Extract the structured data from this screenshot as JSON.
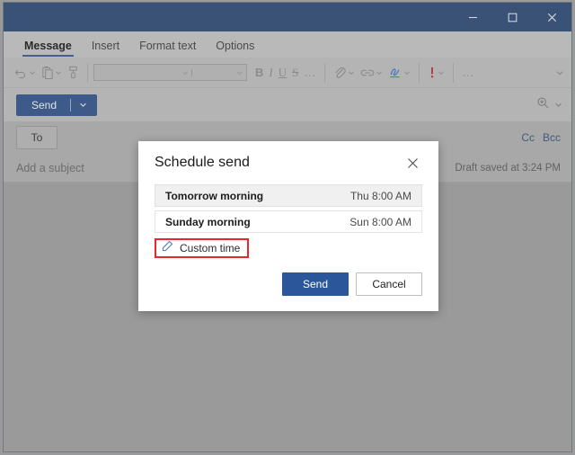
{
  "window": {
    "titlebar": {
      "minimize_label": "Minimize",
      "maximize_label": "Maximize",
      "close_label": "Close",
      "background": "#3a5275"
    }
  },
  "ribbon": {
    "tabs": [
      {
        "label": "Message",
        "active": true
      },
      {
        "label": "Insert",
        "active": false
      },
      {
        "label": "Format text",
        "active": false
      },
      {
        "label": "Options",
        "active": false
      }
    ],
    "toolbar": {
      "undo": "undo-icon",
      "paste": "paste-icon",
      "format_painter": "format-painter-icon",
      "font_name_value": "",
      "font_size_value": "",
      "bold": "B",
      "italic": "I",
      "underline": "U",
      "strikethrough": "S",
      "more_font": "…",
      "attach": "paperclip-icon",
      "link": "link-icon",
      "signature": "signature-icon",
      "importance": "importance-icon",
      "more_commands": "…",
      "collapse_ribbon": "chevron-down-icon"
    }
  },
  "compose": {
    "send_button": "Send",
    "send_dropdown": "chevron-down-icon",
    "zoom_icon": "zoom-in-icon",
    "zoom_caret": "chevron-down-icon",
    "to_button": "To",
    "cc_link": "Cc",
    "bcc_link": "Bcc",
    "subject_placeholder": "Add a subject",
    "draft_status": "Draft saved at 3:24 PM"
  },
  "dialog": {
    "title": "Schedule send",
    "close_icon": "close-icon",
    "options": [
      {
        "label": "Tomorrow morning",
        "time": "Thu 8:00 AM",
        "hovered": true
      },
      {
        "label": "Sunday morning",
        "time": "Sun 8:00 AM",
        "hovered": false
      }
    ],
    "custom_time": {
      "label": "Custom time",
      "icon": "pencil-icon",
      "highlight_color": "#e8262c"
    },
    "send_button": "Send",
    "cancel_button": "Cancel",
    "primary_color": "#2b579a"
  }
}
